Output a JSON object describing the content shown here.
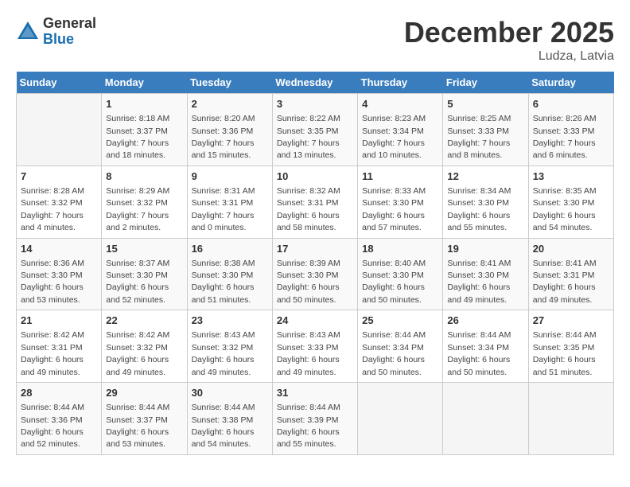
{
  "header": {
    "logo_general": "General",
    "logo_blue": "Blue",
    "month": "December 2025",
    "location": "Ludza, Latvia"
  },
  "days_of_week": [
    "Sunday",
    "Monday",
    "Tuesday",
    "Wednesday",
    "Thursday",
    "Friday",
    "Saturday"
  ],
  "weeks": [
    [
      null,
      {
        "day": "1",
        "sunrise": "Sunrise: 8:18 AM",
        "sunset": "Sunset: 3:37 PM",
        "daylight": "Daylight: 7 hours and 18 minutes."
      },
      {
        "day": "2",
        "sunrise": "Sunrise: 8:20 AM",
        "sunset": "Sunset: 3:36 PM",
        "daylight": "Daylight: 7 hours and 15 minutes."
      },
      {
        "day": "3",
        "sunrise": "Sunrise: 8:22 AM",
        "sunset": "Sunset: 3:35 PM",
        "daylight": "Daylight: 7 hours and 13 minutes."
      },
      {
        "day": "4",
        "sunrise": "Sunrise: 8:23 AM",
        "sunset": "Sunset: 3:34 PM",
        "daylight": "Daylight: 7 hours and 10 minutes."
      },
      {
        "day": "5",
        "sunrise": "Sunrise: 8:25 AM",
        "sunset": "Sunset: 3:33 PM",
        "daylight": "Daylight: 7 hours and 8 minutes."
      },
      {
        "day": "6",
        "sunrise": "Sunrise: 8:26 AM",
        "sunset": "Sunset: 3:33 PM",
        "daylight": "Daylight: 7 hours and 6 minutes."
      }
    ],
    [
      {
        "day": "7",
        "sunrise": "Sunrise: 8:28 AM",
        "sunset": "Sunset: 3:32 PM",
        "daylight": "Daylight: 7 hours and 4 minutes."
      },
      {
        "day": "8",
        "sunrise": "Sunrise: 8:29 AM",
        "sunset": "Sunset: 3:32 PM",
        "daylight": "Daylight: 7 hours and 2 minutes."
      },
      {
        "day": "9",
        "sunrise": "Sunrise: 8:31 AM",
        "sunset": "Sunset: 3:31 PM",
        "daylight": "Daylight: 7 hours and 0 minutes."
      },
      {
        "day": "10",
        "sunrise": "Sunrise: 8:32 AM",
        "sunset": "Sunset: 3:31 PM",
        "daylight": "Daylight: 6 hours and 58 minutes."
      },
      {
        "day": "11",
        "sunrise": "Sunrise: 8:33 AM",
        "sunset": "Sunset: 3:30 PM",
        "daylight": "Daylight: 6 hours and 57 minutes."
      },
      {
        "day": "12",
        "sunrise": "Sunrise: 8:34 AM",
        "sunset": "Sunset: 3:30 PM",
        "daylight": "Daylight: 6 hours and 55 minutes."
      },
      {
        "day": "13",
        "sunrise": "Sunrise: 8:35 AM",
        "sunset": "Sunset: 3:30 PM",
        "daylight": "Daylight: 6 hours and 54 minutes."
      }
    ],
    [
      {
        "day": "14",
        "sunrise": "Sunrise: 8:36 AM",
        "sunset": "Sunset: 3:30 PM",
        "daylight": "Daylight: 6 hours and 53 minutes."
      },
      {
        "day": "15",
        "sunrise": "Sunrise: 8:37 AM",
        "sunset": "Sunset: 3:30 PM",
        "daylight": "Daylight: 6 hours and 52 minutes."
      },
      {
        "day": "16",
        "sunrise": "Sunrise: 8:38 AM",
        "sunset": "Sunset: 3:30 PM",
        "daylight": "Daylight: 6 hours and 51 minutes."
      },
      {
        "day": "17",
        "sunrise": "Sunrise: 8:39 AM",
        "sunset": "Sunset: 3:30 PM",
        "daylight": "Daylight: 6 hours and 50 minutes."
      },
      {
        "day": "18",
        "sunrise": "Sunrise: 8:40 AM",
        "sunset": "Sunset: 3:30 PM",
        "daylight": "Daylight: 6 hours and 50 minutes."
      },
      {
        "day": "19",
        "sunrise": "Sunrise: 8:41 AM",
        "sunset": "Sunset: 3:30 PM",
        "daylight": "Daylight: 6 hours and 49 minutes."
      },
      {
        "day": "20",
        "sunrise": "Sunrise: 8:41 AM",
        "sunset": "Sunset: 3:31 PM",
        "daylight": "Daylight: 6 hours and 49 minutes."
      }
    ],
    [
      {
        "day": "21",
        "sunrise": "Sunrise: 8:42 AM",
        "sunset": "Sunset: 3:31 PM",
        "daylight": "Daylight: 6 hours and 49 minutes."
      },
      {
        "day": "22",
        "sunrise": "Sunrise: 8:42 AM",
        "sunset": "Sunset: 3:32 PM",
        "daylight": "Daylight: 6 hours and 49 minutes."
      },
      {
        "day": "23",
        "sunrise": "Sunrise: 8:43 AM",
        "sunset": "Sunset: 3:32 PM",
        "daylight": "Daylight: 6 hours and 49 minutes."
      },
      {
        "day": "24",
        "sunrise": "Sunrise: 8:43 AM",
        "sunset": "Sunset: 3:33 PM",
        "daylight": "Daylight: 6 hours and 49 minutes."
      },
      {
        "day": "25",
        "sunrise": "Sunrise: 8:44 AM",
        "sunset": "Sunset: 3:34 PM",
        "daylight": "Daylight: 6 hours and 50 minutes."
      },
      {
        "day": "26",
        "sunrise": "Sunrise: 8:44 AM",
        "sunset": "Sunset: 3:34 PM",
        "daylight": "Daylight: 6 hours and 50 minutes."
      },
      {
        "day": "27",
        "sunrise": "Sunrise: 8:44 AM",
        "sunset": "Sunset: 3:35 PM",
        "daylight": "Daylight: 6 hours and 51 minutes."
      }
    ],
    [
      {
        "day": "28",
        "sunrise": "Sunrise: 8:44 AM",
        "sunset": "Sunset: 3:36 PM",
        "daylight": "Daylight: 6 hours and 52 minutes."
      },
      {
        "day": "29",
        "sunrise": "Sunrise: 8:44 AM",
        "sunset": "Sunset: 3:37 PM",
        "daylight": "Daylight: 6 hours and 53 minutes."
      },
      {
        "day": "30",
        "sunrise": "Sunrise: 8:44 AM",
        "sunset": "Sunset: 3:38 PM",
        "daylight": "Daylight: 6 hours and 54 minutes."
      },
      {
        "day": "31",
        "sunrise": "Sunrise: 8:44 AM",
        "sunset": "Sunset: 3:39 PM",
        "daylight": "Daylight: 6 hours and 55 minutes."
      },
      null,
      null,
      null
    ]
  ]
}
